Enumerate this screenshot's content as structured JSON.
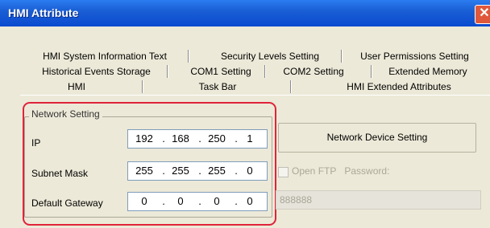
{
  "window": {
    "title": "HMI Attribute",
    "close_glyph": "✕"
  },
  "tabs": {
    "row1": [
      "HMI System Information Text",
      "Security Levels Setting",
      "User Permissions Setting"
    ],
    "row2": [
      "Historical Events Storage",
      "COM1 Setting",
      "COM2 Setting",
      "Extended Memory"
    ],
    "row3": [
      "HMI",
      "Task Bar",
      "HMI Extended Attributes"
    ],
    "active": "HMI"
  },
  "network": {
    "group_label": "Network Setting",
    "ip_label": "IP",
    "ip": [
      "192",
      "168",
      "250",
      "1"
    ],
    "subnet_label": "Subnet Mask",
    "subnet": [
      "255",
      "255",
      "255",
      "0"
    ],
    "gateway_label": "Default Gateway",
    "gateway": [
      "0",
      "0",
      "0",
      "0"
    ]
  },
  "device_button": "Network Device Setting",
  "ftp": {
    "open_label": "Open FTP",
    "password_label": "Password:",
    "password_value": "888888",
    "checked": false
  },
  "colors": {
    "highlight": "#e0233a",
    "titlebar": "#0b4ad0"
  }
}
